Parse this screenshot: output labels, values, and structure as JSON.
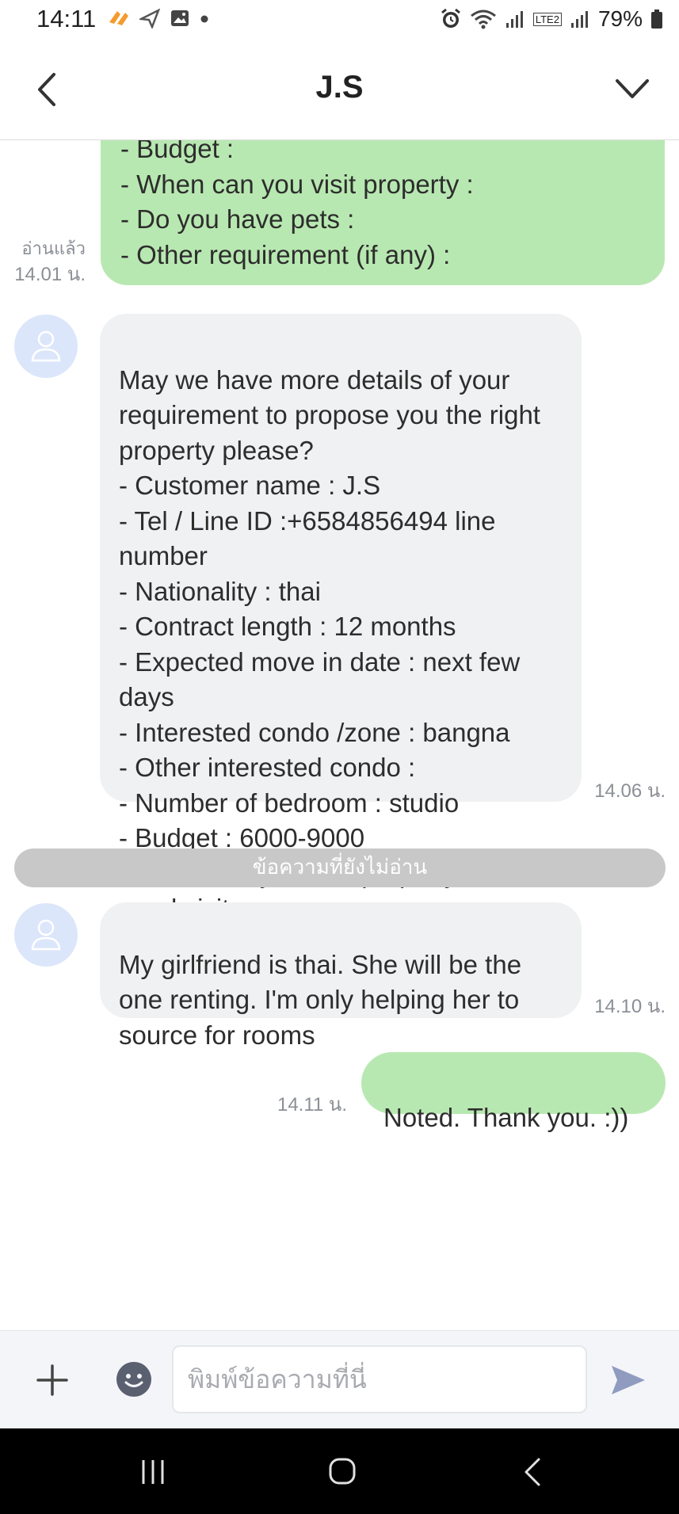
{
  "status_bar": {
    "time": "14:11",
    "battery": "79%",
    "network": "LTE2"
  },
  "header": {
    "title": "J.S"
  },
  "messages": {
    "m1": {
      "text": "- Budget :\n- When can you visit property :\n- Do you have pets :\n- Other requirement (if any) :",
      "read": "อ่านแล้ว",
      "time": "14.01 น."
    },
    "m2": {
      "text": "May we have more details of your requirement to propose you the right property please?\n- Customer name : J.S\n- Tel / Line ID :+6584856494 line number\n- Nationality : thai\n- Contract length : 12 months\n- Expected move in date : next few days\n- Interested condo /zone : bangna\n- Other interested condo :\n- Number of bedroom  : studio\n- Budget : 6000-9000\n- When can you visit property : no need visit\n- Do you have pets : no\n- Other requirement (if any) :",
      "time": "14.06 น."
    },
    "unread_label": "ข้อความที่ยังไม่อ่าน",
    "m3": {
      "text": "My girlfriend is thai. She will be the one renting. I'm only helping her to source for rooms",
      "time": "14.10 น."
    },
    "m4": {
      "text": "Noted. Thank you. :))",
      "time": "14.11 น."
    }
  },
  "input": {
    "placeholder": "พิมพ์ข้อความที่นี่"
  },
  "icons": {
    "back": "chevron-left-icon",
    "menu": "chevron-down-icon",
    "plus": "plus-icon",
    "emoji": "emoji-icon",
    "send": "send-icon"
  },
  "colors": {
    "outgoing_bubble": "#b8e8b1",
    "incoming_bubble": "#f0f1f3",
    "send_icon": "#8f9cc0"
  }
}
